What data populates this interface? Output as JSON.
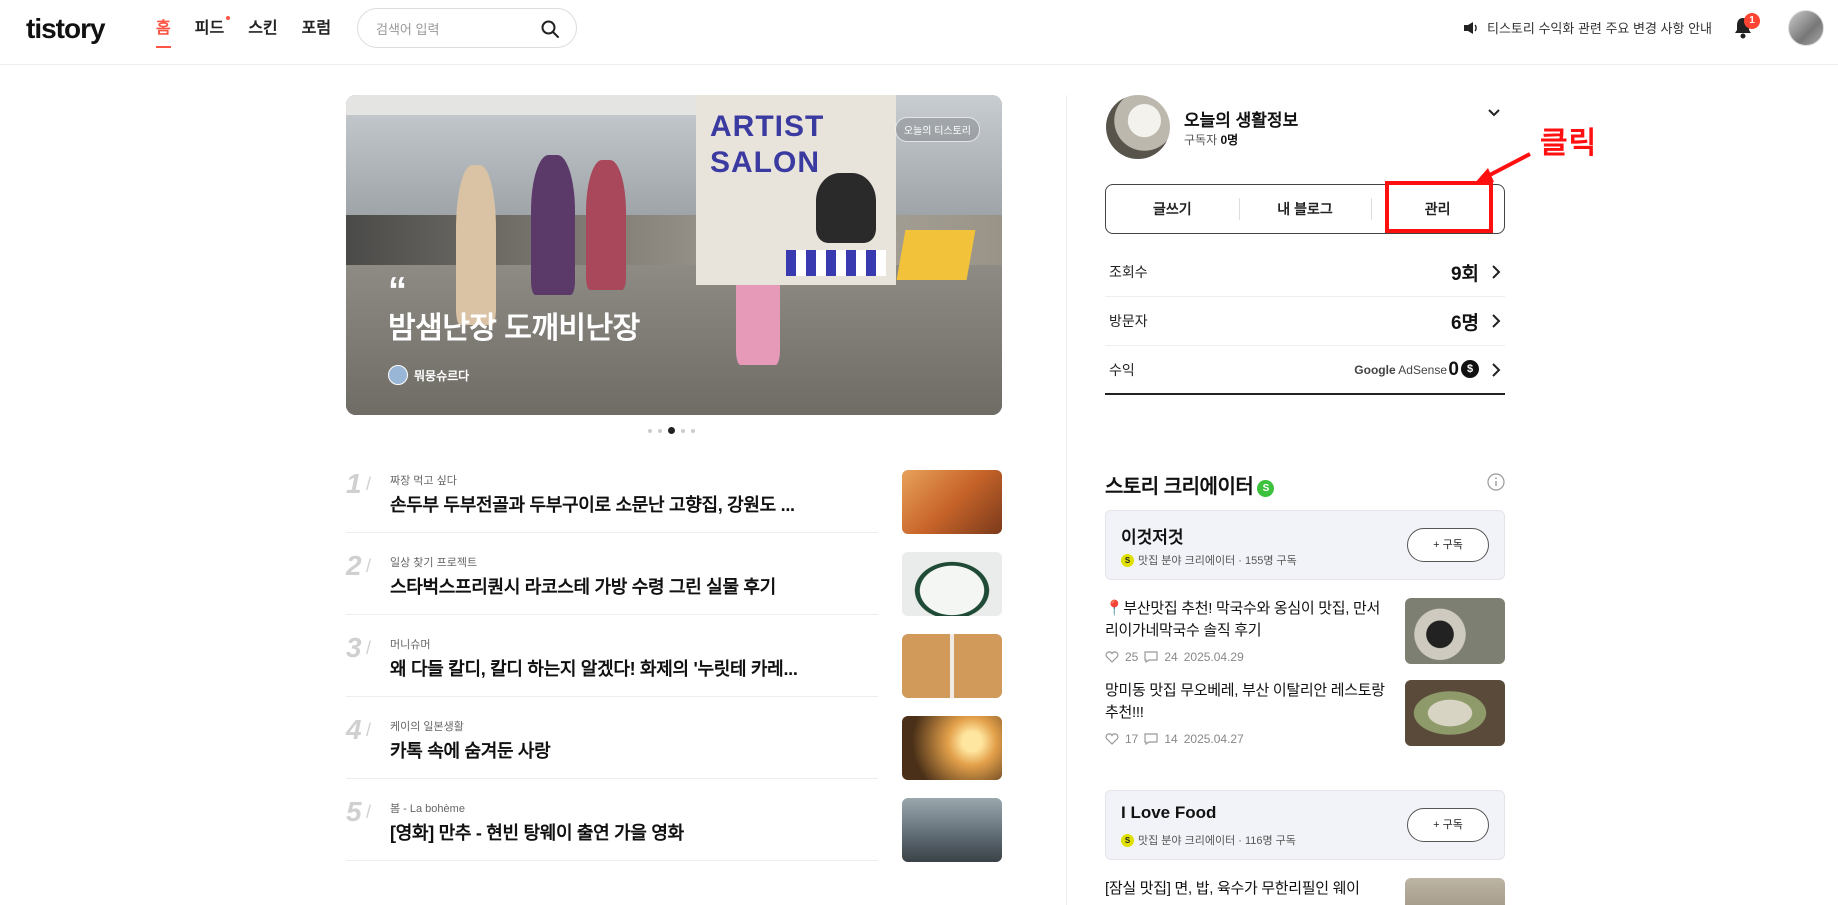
{
  "header": {
    "logo": "tistory",
    "nav": [
      "홈",
      "피드",
      "스킨",
      "포럼"
    ],
    "search_placeholder": "검색어 입력",
    "notice_text": "티스토리 수익화 관련 주요 변경 사항 안내",
    "notification_count": "1"
  },
  "hero": {
    "badge": "오늘의 티스토리",
    "quote_mark": "“",
    "title": "밤샘난장 도깨비난장",
    "author": "뭐뭉슈르다",
    "poster_text": "ARTIST SALON",
    "slide_count": 5,
    "active_slide": 2
  },
  "ranking": [
    {
      "num": "1",
      "category": "짜장 먹고 싶다",
      "title": "손두부 두부전골과 두부구이로 소문난 고향집, 강원도 ...",
      "thumb_color": "#c8642a"
    },
    {
      "num": "2",
      "category": "일상 찾기 프로젝트",
      "title": "스타벅스프리퀀시 라코스테 가방 수령 그린 실물 후기",
      "thumb_color": "#e9ecea"
    },
    {
      "num": "3",
      "category": "머니슈머",
      "title": "왜 다들 칼디, 칼디 하는지 알겠다! 화제의 '누릿테 카레...",
      "thumb_color": "#b88a4e"
    },
    {
      "num": "4",
      "category": "케이의 일본생활",
      "title": "카톡 속에 숨겨둔 사랑",
      "thumb_color": "#7a5a2e"
    },
    {
      "num": "5",
      "category": "봄 - La bohème",
      "title": "[영화] 만추 - 현빈 탕웨이 출연 가을 영화",
      "thumb_color": "#5d6a72"
    }
  ],
  "profile": {
    "blog_name": "오늘의 생활정보",
    "subscriber_label": "구독자",
    "subscriber_count": "0명",
    "buttons": [
      "글쓰기",
      "내 블로그",
      "관리"
    ]
  },
  "annotation": {
    "text": "클릭",
    "color": "#ff1010"
  },
  "stats": [
    {
      "label": "조회수",
      "value": "9회"
    },
    {
      "label": "방문자",
      "value": "6명"
    },
    {
      "label": "수익",
      "value": "0",
      "extra_google": "Google",
      "extra_adsense": "AdSense",
      "currency": "$"
    }
  ],
  "creators_section": {
    "title": "스토리 크리에이터",
    "badge": "S",
    "creators": [
      {
        "name": "이것저것",
        "meta": "맛집 분야 크리에이터 · 155명 구독",
        "button": "+ 구독"
      },
      {
        "name": "I Love Food",
        "meta": "맛집 분야 크리에이터 · 116명 구독",
        "button": "+ 구독"
      }
    ],
    "posts": [
      {
        "title": "📍부산맛집 추천! 막국수와 옹심이 맛집, 만서리이가네막국수 솔직 후기",
        "likes": "25",
        "comments": "24",
        "date": "2025.04.29",
        "thumb_color": "#7c7f72"
      },
      {
        "title": "망미동 맛집 무오베레, 부산 이탈리안 레스토랑 추천!!!",
        "likes": "17",
        "comments": "14",
        "date": "2025.04.27",
        "thumb_color": "#8f9a6a"
      },
      {
        "title": "[잠실 맛집] 면, 밥, 육수가 무한리필인 웨이"
      }
    ]
  },
  "colors": {
    "accent": "#ff5544",
    "badge_green": "#3cc23c"
  }
}
